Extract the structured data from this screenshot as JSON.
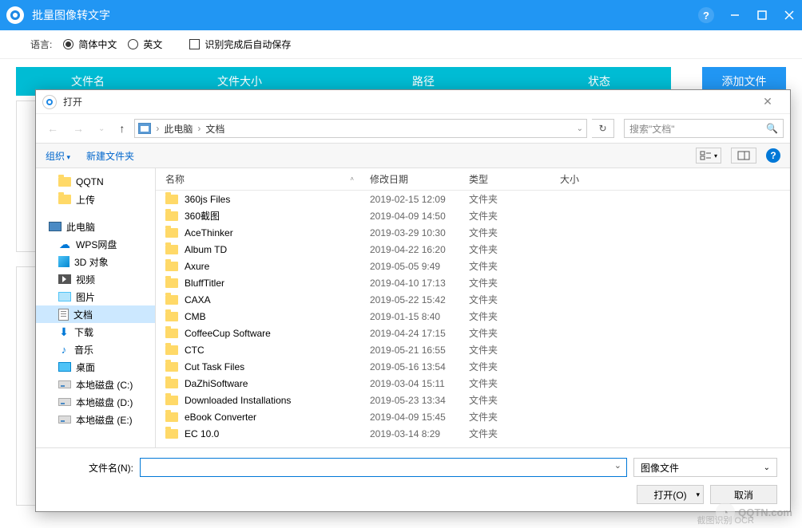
{
  "app": {
    "title": "批量图像转文字",
    "help": "?",
    "toolbar": {
      "lang_label": "语言:",
      "lang_zh": "简体中文",
      "lang_en": "英文",
      "autosave": "识别完成后自动保存"
    },
    "tabs": {
      "filename": "文件名",
      "filesize": "文件大小",
      "path": "路径",
      "status": "状态"
    },
    "add_file": "添加文件"
  },
  "dialog": {
    "title": "打开",
    "breadcrumb": {
      "sep": "›",
      "pc": "此电脑",
      "docs": "文档"
    },
    "search_placeholder": "搜索\"文档\"",
    "toolbar": {
      "organize": "组织",
      "new_folder": "新建文件夹"
    },
    "columns": {
      "name": "名称",
      "date": "修改日期",
      "type": "类型",
      "size": "大小"
    },
    "tree": {
      "qqtn": "QQTN",
      "upload": "上传",
      "this_pc": "此电脑",
      "wps": "WPS网盘",
      "obj3d": "3D 对象",
      "video": "视频",
      "pictures": "图片",
      "documents": "文档",
      "downloads": "下载",
      "music": "音乐",
      "desktop": "桌面",
      "disk_c": "本地磁盘 (C:)",
      "disk_d": "本地磁盘 (D:)",
      "disk_e": "本地磁盘 (E:)"
    },
    "files": [
      {
        "name": "360js Files",
        "date": "2019-02-15 12:09",
        "type": "文件夹"
      },
      {
        "name": "360截图",
        "date": "2019-04-09 14:50",
        "type": "文件夹"
      },
      {
        "name": "AceThinker",
        "date": "2019-03-29 10:30",
        "type": "文件夹"
      },
      {
        "name": "Album TD",
        "date": "2019-04-22 16:20",
        "type": "文件夹"
      },
      {
        "name": "Axure",
        "date": "2019-05-05 9:49",
        "type": "文件夹"
      },
      {
        "name": "BluffTitler",
        "date": "2019-04-10 17:13",
        "type": "文件夹"
      },
      {
        "name": "CAXA",
        "date": "2019-05-22 15:42",
        "type": "文件夹"
      },
      {
        "name": "CMB",
        "date": "2019-01-15 8:40",
        "type": "文件夹"
      },
      {
        "name": "CoffeeCup Software",
        "date": "2019-04-24 17:15",
        "type": "文件夹"
      },
      {
        "name": "CTC",
        "date": "2019-05-21 16:55",
        "type": "文件夹"
      },
      {
        "name": "Cut Task Files",
        "date": "2019-05-16 13:54",
        "type": "文件夹"
      },
      {
        "name": "DaZhiSoftware",
        "date": "2019-03-04 15:11",
        "type": "文件夹"
      },
      {
        "name": "Downloaded Installations",
        "date": "2019-05-23 13:34",
        "type": "文件夹"
      },
      {
        "name": "eBook Converter",
        "date": "2019-04-09 15:45",
        "type": "文件夹"
      },
      {
        "name": "EC 10.0",
        "date": "2019-03-14 8:29",
        "type": "文件夹"
      }
    ],
    "footer": {
      "filename_label": "文件名(N):",
      "filter": "图像文件",
      "open": "打开(O)",
      "cancel": "取消"
    }
  },
  "watermark": "QQTN.com",
  "footer_overlay": "截图识别 OCR"
}
